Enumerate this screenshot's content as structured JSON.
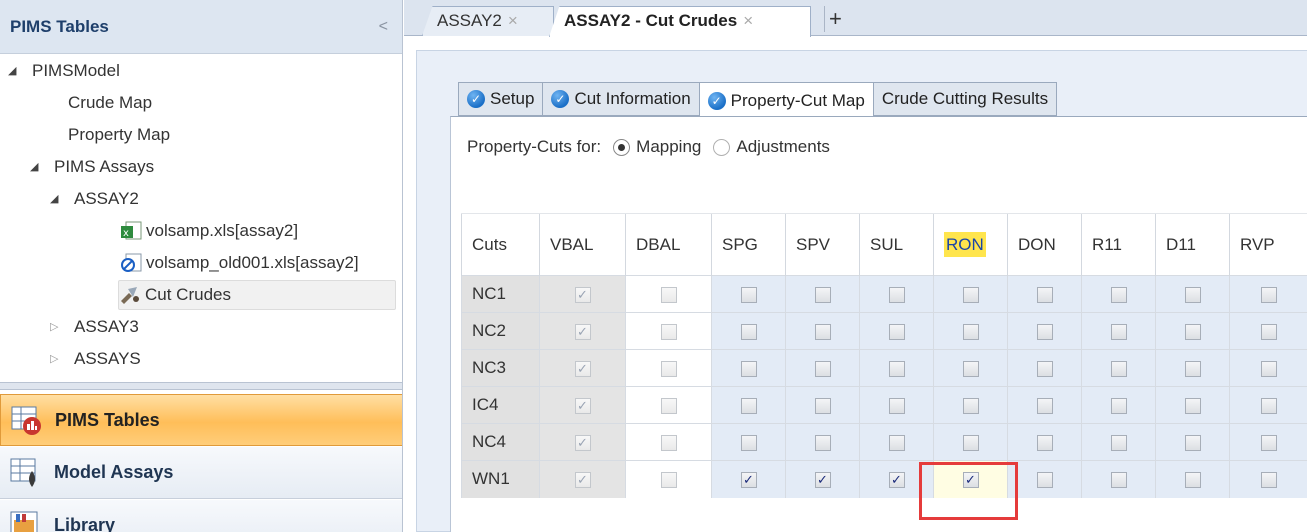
{
  "left_panel": {
    "title": "PIMS Tables",
    "collapse_glyph": "<",
    "tree": {
      "root": "PIMSModel",
      "crude_map": "Crude Map",
      "property_map": "Property Map",
      "pims_assays": "PIMS Assays",
      "assay2": "ASSAY2",
      "file1": "volsamp.xls[assay2]",
      "file2": "volsamp_old001.xls[assay2]",
      "cut_crudes": "Cut Crudes",
      "assay3": "ASSAY3",
      "assays": "ASSAYS"
    },
    "nav": {
      "pims_tables": "PIMS Tables",
      "model_assays": "Model Assays",
      "library": "Library"
    }
  },
  "doc_tabs": {
    "tab1": "ASSAY2",
    "tab2": "ASSAY2 - Cut Crudes",
    "close_glyph": "×",
    "new_tab_glyph": "+"
  },
  "inner_tabs": {
    "setup": "Setup",
    "cut_information": "Cut Information",
    "property_cut_map": "Property-Cut Map",
    "crude_cutting_results": "Crude Cutting Results"
  },
  "property_cuts": {
    "label": "Property-Cuts for:",
    "mapping": "Mapping",
    "adjustments": "Adjustments",
    "selected": "Mapping"
  },
  "grid": {
    "col_cuts": "Cuts",
    "col_vbal": "VBAL",
    "col_dbal": "DBAL",
    "col_spg": "SPG",
    "col_spv": "SPV",
    "col_sul": "SUL",
    "col_ron": "RON",
    "col_don": "DON",
    "col_r11": "R11",
    "col_d11": "D11",
    "col_rvp": "RVP",
    "rows": {
      "nc1": "NC1",
      "nc2": "NC2",
      "nc3": "NC3",
      "ic4": "IC4",
      "nc4": "NC4",
      "wn1": "WN1"
    },
    "checked_glyph": "✓",
    "wn1_checked": [
      "VBAL",
      "SPG",
      "SPV",
      "SUL",
      "RON"
    ],
    "vbal_checked_all": true
  },
  "colors": {
    "accent_orange": "#ffbe59",
    "highlight_yellow": "#ffe54d",
    "selection_red": "#e53b3b",
    "header_blue": "#1e3f6b"
  }
}
